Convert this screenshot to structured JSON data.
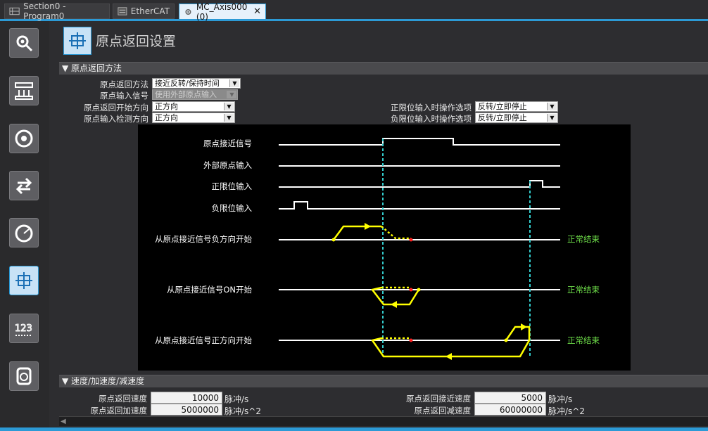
{
  "tabs": [
    {
      "label": "Section0 - Program0",
      "icon": "ladder-program-icon"
    },
    {
      "label": "EtherCAT",
      "icon": "ethercat-icon"
    },
    {
      "label": "MC_Axis000 (0)",
      "icon": "gear-icon",
      "active": true,
      "close": "✕"
    }
  ],
  "sidebar": [
    "settings-search-icon",
    "unit-conversion-icon",
    "rotation-icon",
    "operation-direction-icon",
    "speed-gauge-icon",
    "homing-icon",
    "position-count-icon",
    "servo-icon"
  ],
  "page": {
    "title": "原点返回设置"
  },
  "sections": {
    "method": "▼ 原点返回方法",
    "speed": "▼ 速度/加速度/减速度"
  },
  "method": {
    "homing_method": {
      "label": "原点返回方法",
      "value": "接近反转/保持时间"
    },
    "home_input_signal": {
      "label": "原点输入信号",
      "value": "使用外部原点输入"
    },
    "start_direction": {
      "label": "原点返回开始方向",
      "value": "正方向"
    },
    "detect_direction": {
      "label": "原点输入检测方向",
      "value": "正方向"
    },
    "pos_limit_op": {
      "label": "正限位输入时操作选项",
      "value": "反转/立即停止"
    },
    "neg_limit_op": {
      "label": "负限位输入时操作选项",
      "value": "反转/立即停止"
    }
  },
  "diagram": {
    "signals": [
      "原点接近信号",
      "外部原点输入",
      "正限位输入",
      "负限位输入"
    ],
    "cases": [
      "从原点接近信号负方向开始",
      "从原点接近信号ON开始",
      "从原点接近信号正方向开始"
    ],
    "end_label": "正常结束",
    "colors": {
      "line": "#ffffff",
      "path": "#ffff00",
      "marker": "#33cccc",
      "stop": "#ff2020",
      "end": "#6fe04a"
    }
  },
  "speed": {
    "homing_speed": {
      "label": "原点返回速度",
      "value": "10000",
      "unit": "脉冲/s"
    },
    "homing_accel": {
      "label": "原点返回加速度",
      "value": "5000000",
      "unit": "脉冲/s^2"
    },
    "approach_speed": {
      "label": "原点返回接近速度",
      "value": "5000",
      "unit": "脉冲/s"
    },
    "homing_decel": {
      "label": "原点返回减速度",
      "value": "60000000",
      "unit": "脉冲/s^2"
    }
  },
  "arrow": "▼",
  "scroll_left": "◀"
}
